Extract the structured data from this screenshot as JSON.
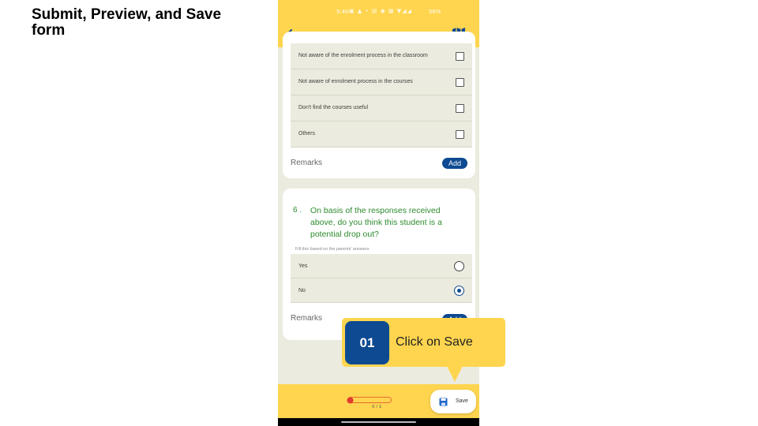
{
  "slide": {
    "title": "Submit, Preview, and Save form"
  },
  "status_bar": {
    "time": "5:40",
    "icons": "▣ ▲ •   ▤ ◉ ▦ ▼◢◢",
    "battery": "56%"
  },
  "app_bar": {
    "back_icon": "arrow-left-icon",
    "map_icon": "map-icon"
  },
  "question5": {
    "options": [
      {
        "label": "Not aware of the enrolment process in the classroom",
        "checked": false
      },
      {
        "label": "Not aware of enrolment process in the courses",
        "checked": false
      },
      {
        "label": "Don't find the courses useful",
        "checked": false
      },
      {
        "label": "Others",
        "checked": false
      }
    ],
    "remarks_label": "Remarks",
    "add_label": "Add"
  },
  "question6": {
    "number": "6 .",
    "text": "On basis of the responses received above, do you think this student is a potential drop out?",
    "hint": "Fill this based on the parents' answers",
    "options": [
      {
        "label": "Yes",
        "selected": false
      },
      {
        "label": "No",
        "selected": true
      }
    ],
    "remarks_label": "Remarks",
    "add_label": "Add"
  },
  "bottom_bar": {
    "progress_text": "0 / 1",
    "progress_fraction": 0,
    "save_label": "Save",
    "save_icon": "save-floppy-icon"
  },
  "callout": {
    "number": "01",
    "text": "Click on Save"
  },
  "colors": {
    "accent_yellow": "#ffd54f",
    "primary_blue": "#0d4a91",
    "question_green": "#2e8b2e",
    "progress_red": "#e23b2f"
  }
}
